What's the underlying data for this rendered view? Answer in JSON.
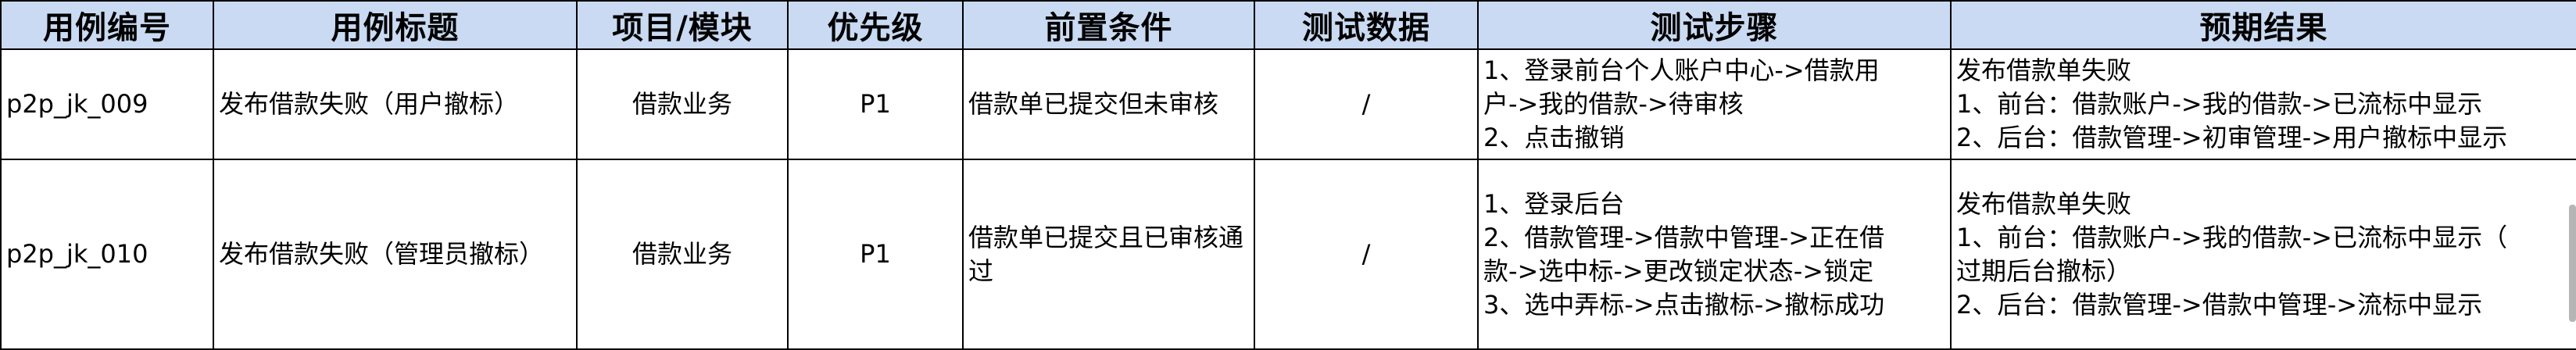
{
  "headers": [
    "用例编号",
    "用例标题",
    "项目/模块",
    "优先级",
    "前置条件",
    "测试数据",
    "测试步骤",
    "预期结果"
  ],
  "rows": [
    {
      "id": "p2p_jk_009",
      "title": "发布借款失败（用户撤标）",
      "module": "借款业务",
      "priority": "P1",
      "precondition": "借款单已提交但未审核",
      "test_data": "/",
      "steps": [
        "1、登录前台个人账户中心->借款用",
        "户->我的借款->待审核",
        "2、点击撤销"
      ],
      "expected": [
        "发布借款单失败",
        "1、前台：借款账户->我的借款->已流标中显示",
        "2、后台：借款管理->初审管理->用户撤标中显示"
      ]
    },
    {
      "id": "p2p_jk_010",
      "title": "发布借款失败（管理员撤标）",
      "module": "借款业务",
      "priority": "P1",
      "precondition": "借款单已提交且已审核通过",
      "test_data": "/",
      "steps": [
        "1、登录后台",
        "2、借款管理->借款中管理->正在借",
        "款->选中标->更改锁定状态->锁定",
        "3、选中弄标->点击撤标->撤标成功"
      ],
      "expected": [
        "发布借款单失败",
        "1、前台：借款账户->我的借款->已流标中显示（",
        "过期后台撤标）",
        "2、后台：借款管理->借款中管理->流标中显示"
      ]
    }
  ]
}
